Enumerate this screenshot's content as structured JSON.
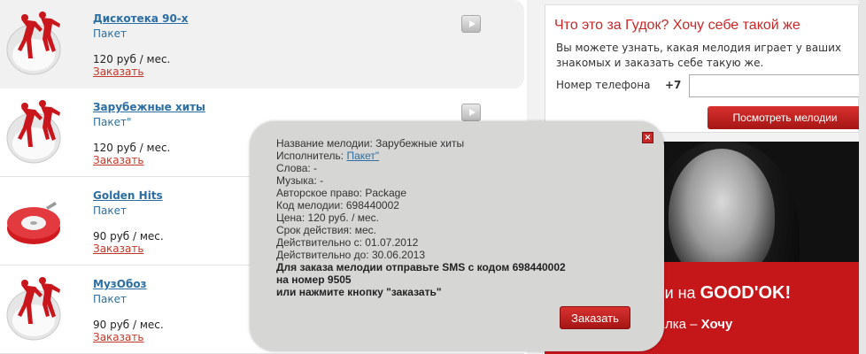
{
  "list": {
    "items": [
      {
        "title": "Дискотека 90-х",
        "sub": "Пакет",
        "price": "120 руб / мес.",
        "order": "Заказать",
        "icon": "dancers-icon"
      },
      {
        "title": "Зарубежные хиты",
        "sub": "Пакет\"",
        "price": "120 руб / мес.",
        "order": "Заказать",
        "icon": "dancers-icon"
      },
      {
        "title": "Golden Hits",
        "sub": "Пакет",
        "price": "90 руб / мес.",
        "order": "Заказать",
        "icon": "vinyl-icon"
      },
      {
        "title": "МузОбоз",
        "sub": "Пакет",
        "price": "90 руб / мес.",
        "order": "Заказать",
        "icon": "dancers-icon"
      }
    ]
  },
  "right": {
    "heading": "Что это за Гудок? Хочу себе такой же",
    "desc": "Вы можете узнать, какая мелодия играет у ваших знакомых и заказать себе такую же.",
    "phone_label": "Номер телефона",
    "prefix": "+7",
    "phone_value": "",
    "show_button": "Посмотреть мелодии"
  },
  "banner": {
    "line1_part": "ви на ",
    "line1_brand": "GOOD'OK!",
    "line2_part": "Елка – ",
    "line2_bold": "Хочу"
  },
  "popup": {
    "close": "×",
    "name": "Название мелодии: Зарубежные хиты",
    "artist_label": "Исполнитель: ",
    "artist_link": "Пакет\"",
    "words": "Слова: -",
    "music": "Музыка: -",
    "copyright": "Авторское право: Package",
    "code": "Код мелодии: 698440002",
    "price": "Цена: 120 руб. / мес.",
    "period": "Срок действия: мес.",
    "valid_from": "Действительно с: 01.07.2012",
    "valid_to": "Действительно до: 30.06.2013",
    "instr1": "Для заказа мелодии отправьте SMS с кодом 698440002",
    "instr2": "на номер 9505",
    "instr3": "или нажмите кнопку \"заказать\"",
    "order_button": "Заказать"
  },
  "colors": {
    "accent": "#c62828",
    "link": "#2b6ea3"
  }
}
